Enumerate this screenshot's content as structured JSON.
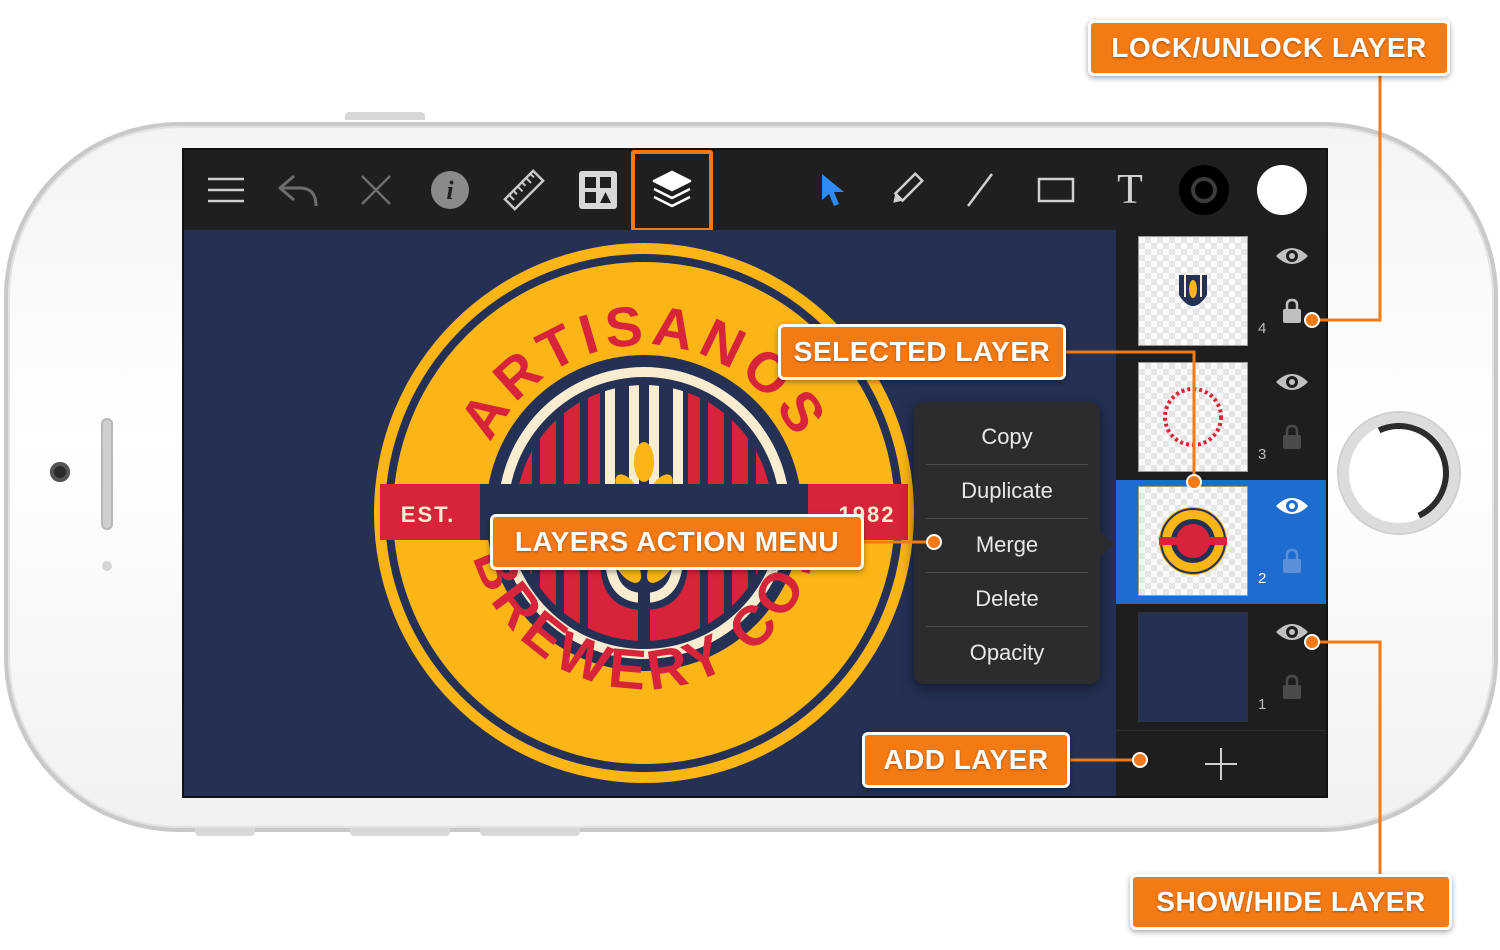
{
  "toolbar": {
    "icons": [
      "menu-icon",
      "undo-icon",
      "close-icon",
      "info-icon",
      "ruler-icon",
      "grid-icon",
      "layers-icon",
      "select-arrow-icon",
      "pencil-icon",
      "line-icon",
      "rectangle-icon",
      "text-icon",
      "stroke-color-icon",
      "fill-color-icon"
    ],
    "text_tool_label": "T"
  },
  "logo": {
    "top_text": "ARTISANOS",
    "bottom_text": "BREWERY CO.",
    "est_label": "EST.",
    "year": "1982",
    "colors": {
      "navy": "#243155",
      "yellow": "#fbb515",
      "red": "#d8243a",
      "cream": "#f8edd0"
    }
  },
  "action_menu": {
    "items": [
      "Copy",
      "Duplicate",
      "Merge",
      "Delete",
      "Opacity"
    ]
  },
  "layers": [
    {
      "number": "4",
      "selected": false,
      "locked": true
    },
    {
      "number": "3",
      "selected": false,
      "locked": false
    },
    {
      "number": "2",
      "selected": true,
      "locked": false
    },
    {
      "number": "1",
      "selected": false,
      "locked": false
    }
  ],
  "callouts": {
    "lock_unlock": "LOCK/UNLOCK LAYER",
    "selected_layer": "SELECTED LAYER",
    "layers_action_menu": "LAYERS ACTION MENU",
    "add_layer": "ADD LAYER",
    "show_hide": "SHOW/HIDE LAYER"
  },
  "colors": {
    "accent": "#f47a14",
    "selection": "#1f6cd1",
    "active_tool": "#2f8af5"
  }
}
